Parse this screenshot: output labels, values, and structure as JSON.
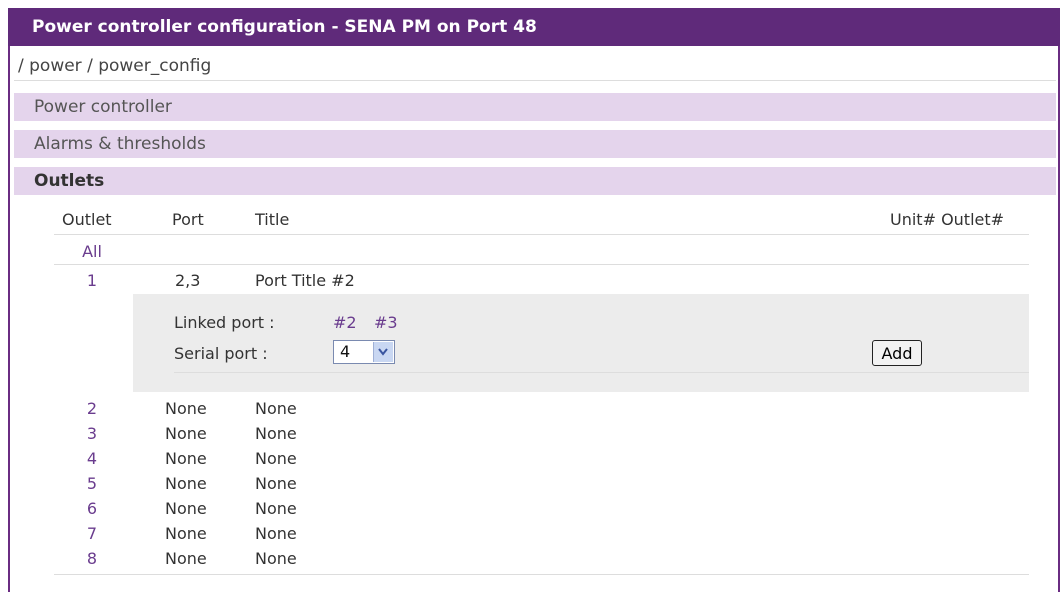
{
  "header": {
    "title": "Power controller configuration - SENA PM on Port 48"
  },
  "breadcrumb": "/ power / power_config",
  "sections": [
    {
      "label": "Power controller",
      "active": false
    },
    {
      "label": "Alarms & thresholds",
      "active": false
    },
    {
      "label": "Outlets",
      "active": true
    }
  ],
  "table": {
    "columns": {
      "outlet": "Outlet",
      "port": "Port",
      "title": "Title",
      "unit_outlet": "Unit# Outlet#"
    },
    "all_label": "All",
    "rows": [
      {
        "outlet": "1",
        "port": "2,3",
        "title": "Port Title #2"
      },
      {
        "outlet": "2",
        "port": "None",
        "title": "None"
      },
      {
        "outlet": "3",
        "port": "None",
        "title": "None"
      },
      {
        "outlet": "4",
        "port": "None",
        "title": "None"
      },
      {
        "outlet": "5",
        "port": "None",
        "title": "None"
      },
      {
        "outlet": "6",
        "port": "None",
        "title": "None"
      },
      {
        "outlet": "7",
        "port": "None",
        "title": "None"
      },
      {
        "outlet": "8",
        "port": "None",
        "title": "None"
      }
    ]
  },
  "detail": {
    "linked_port_label": "Linked port :",
    "linked_ports": [
      "#2",
      "#3"
    ],
    "serial_port_label": "Serial port :",
    "serial_port_value": "4",
    "add_label": "Add"
  },
  "colors": {
    "header_bg": "#5f2a7a",
    "section_bg": "#e4d4ec",
    "link": "#6a3c8e"
  }
}
